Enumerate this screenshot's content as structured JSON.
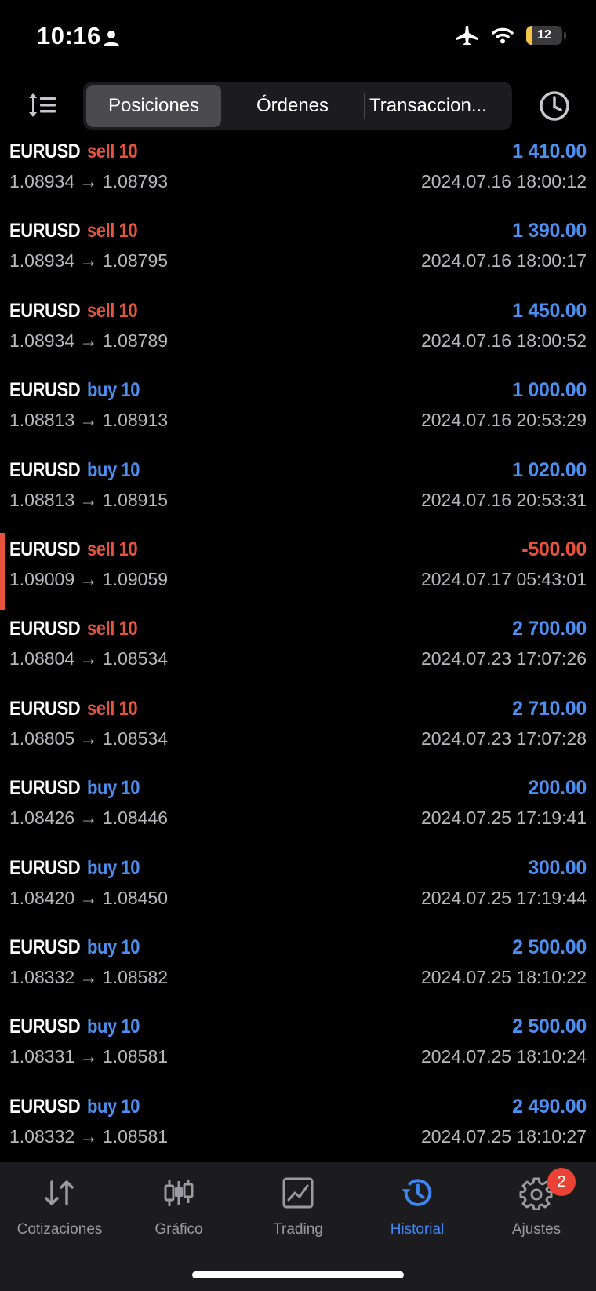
{
  "status_bar": {
    "time": "10:16",
    "battery_level": "12",
    "icons": [
      "person-icon",
      "airplane-icon",
      "wifi-icon",
      "battery-icon"
    ]
  },
  "toolbar": {
    "tabs": [
      {
        "label": "Posiciones",
        "active": true
      },
      {
        "label": "Órdenes",
        "active": false
      },
      {
        "label": "Transaccion...",
        "active": false
      }
    ]
  },
  "positions": [
    {
      "symbol": "EURUSD",
      "side": "sell 10",
      "type": "sell",
      "profit": "1 410.00",
      "open": "1.08934",
      "close": "1.08793",
      "time": "2024.07.16 18:00:12"
    },
    {
      "symbol": "EURUSD",
      "side": "sell 10",
      "type": "sell",
      "profit": "1 390.00",
      "open": "1.08934",
      "close": "1.08795",
      "time": "2024.07.16 18:00:17"
    },
    {
      "symbol": "EURUSD",
      "side": "sell 10",
      "type": "sell",
      "profit": "1 450.00",
      "open": "1.08934",
      "close": "1.08789",
      "time": "2024.07.16 18:00:52"
    },
    {
      "symbol": "EURUSD",
      "side": "buy 10",
      "type": "buy",
      "profit": "1 000.00",
      "open": "1.08813",
      "close": "1.08913",
      "time": "2024.07.16 20:53:29"
    },
    {
      "symbol": "EURUSD",
      "side": "buy 10",
      "type": "buy",
      "profit": "1 020.00",
      "open": "1.08813",
      "close": "1.08915",
      "time": "2024.07.16 20:53:31"
    },
    {
      "symbol": "EURUSD",
      "side": "sell 10",
      "type": "sell",
      "profit": "-500.00",
      "open": "1.09009",
      "close": "1.09059",
      "time": "2024.07.17 05:43:01"
    },
    {
      "symbol": "EURUSD",
      "side": "sell 10",
      "type": "sell",
      "profit": "2 700.00",
      "open": "1.08804",
      "close": "1.08534",
      "time": "2024.07.23 17:07:26"
    },
    {
      "symbol": "EURUSD",
      "side": "sell 10",
      "type": "sell",
      "profit": "2 710.00",
      "open": "1.08805",
      "close": "1.08534",
      "time": "2024.07.23 17:07:28"
    },
    {
      "symbol": "EURUSD",
      "side": "buy 10",
      "type": "buy",
      "profit": "200.00",
      "open": "1.08426",
      "close": "1.08446",
      "time": "2024.07.25 17:19:41"
    },
    {
      "symbol": "EURUSD",
      "side": "buy 10",
      "type": "buy",
      "profit": "300.00",
      "open": "1.08420",
      "close": "1.08450",
      "time": "2024.07.25 17:19:44"
    },
    {
      "symbol": "EURUSD",
      "side": "buy 10",
      "type": "buy",
      "profit": "2 500.00",
      "open": "1.08332",
      "close": "1.08582",
      "time": "2024.07.25 18:10:22"
    },
    {
      "symbol": "EURUSD",
      "side": "buy 10",
      "type": "buy",
      "profit": "2 500.00",
      "open": "1.08331",
      "close": "1.08581",
      "time": "2024.07.25 18:10:24"
    },
    {
      "symbol": "EURUSD",
      "side": "buy 10",
      "type": "buy",
      "profit": "2 490.00",
      "open": "1.08332",
      "close": "1.08581",
      "time": "2024.07.25 18:10:27"
    }
  ],
  "arrow": "→",
  "tabbar": {
    "tabs": [
      {
        "label": "Cotizaciones",
        "icon": "quotes-icon",
        "active": false
      },
      {
        "label": "Gráfico",
        "icon": "chart-icon",
        "active": false
      },
      {
        "label": "Trading",
        "icon": "trading-icon",
        "active": false
      },
      {
        "label": "Historial",
        "icon": "history-icon",
        "active": true
      },
      {
        "label": "Ajustes",
        "icon": "settings-icon",
        "active": false,
        "badge": "2"
      }
    ]
  },
  "colors": {
    "sell": "#e5533d",
    "buy": "#4d8ff0",
    "active_tab": "#3f86f5",
    "background": "#000000"
  }
}
